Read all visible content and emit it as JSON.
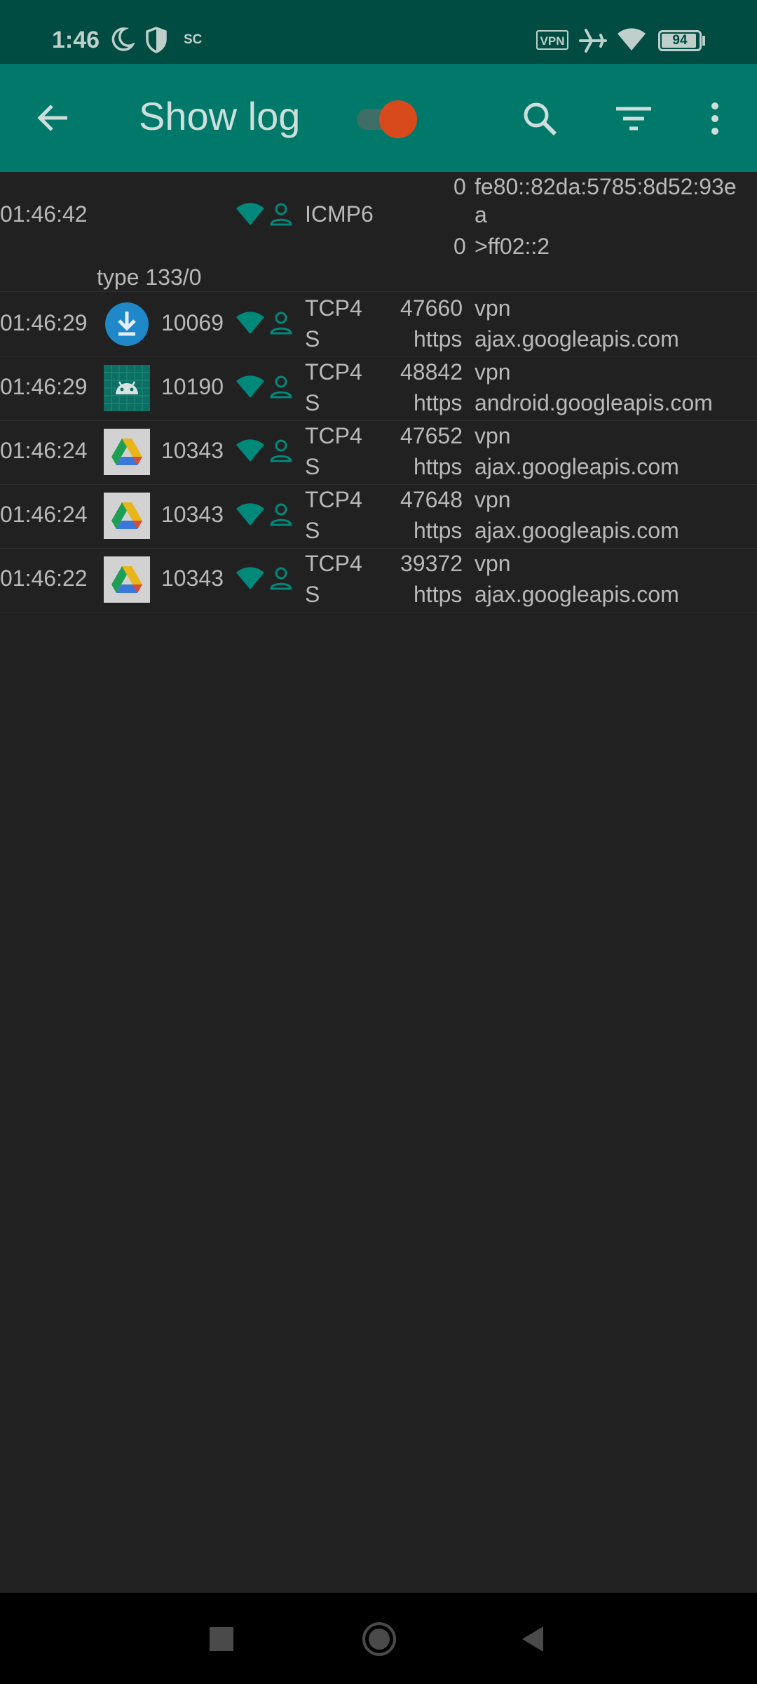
{
  "status_bar": {
    "time": "1:46",
    "sc_label": "SC",
    "vpn_label": "VPN",
    "battery_level": 94,
    "battery_text": "94",
    "icons": [
      "moon-icon",
      "shield-icon",
      "sc-icon",
      "vpn-icon",
      "airplane-icon",
      "wifi-icon",
      "battery-icon"
    ]
  },
  "toolbar": {
    "title": "Show log",
    "toggle_on": true,
    "icons": [
      "back-arrow-icon",
      "search-icon",
      "filter-icon",
      "more-vert-icon"
    ]
  },
  "log": {
    "icmp_entry": {
      "time": "01:46:42",
      "protocol": "ICMP6",
      "src_port": "0",
      "src_addr_line1": "fe80::82da:5785:8d52:93e",
      "src_addr_line2": "a",
      "dst_port": "0",
      "dst_addr": ">ff02::2",
      "type": "type 133/0"
    },
    "entries": [
      {
        "time": "01:46:29",
        "app_icon": "download-icon",
        "uid": "10069",
        "protocol": "TCP4",
        "flags": "S",
        "port": "47660",
        "dest": "vpn",
        "service": "https",
        "host": "ajax.googleapis.com"
      },
      {
        "time": "01:46:29",
        "app_icon": "android-icon",
        "uid": "10190",
        "protocol": "TCP4",
        "flags": "S",
        "port": "48842",
        "dest": "vpn",
        "service": "https",
        "host": "android.googleapis.com"
      },
      {
        "time": "01:46:24",
        "app_icon": "google-drive-icon",
        "uid": "10343",
        "protocol": "TCP4",
        "flags": "S",
        "port": "47652",
        "dest": "vpn",
        "service": "https",
        "host": "ajax.googleapis.com"
      },
      {
        "time": "01:46:24",
        "app_icon": "google-drive-icon",
        "uid": "10343",
        "protocol": "TCP4",
        "flags": "S",
        "port": "47648",
        "dest": "vpn",
        "service": "https",
        "host": "ajax.googleapis.com"
      },
      {
        "time": "01:46:22",
        "app_icon": "google-drive-icon",
        "uid": "10343",
        "protocol": "TCP4",
        "flags": "S",
        "port": "39372",
        "dest": "vpn",
        "service": "https",
        "host": "ajax.googleapis.com"
      }
    ]
  },
  "nav_bar": {
    "icons": [
      "recents-square-icon",
      "home-circle-icon",
      "back-triangle-icon"
    ]
  },
  "colors": {
    "status_bar_bg": "#004c42",
    "toolbar_bg": "#00796b",
    "background": "#212121",
    "accent_teal": "#00796b",
    "toggle_thumb": "#d84a1c",
    "text": "#b9b9b9"
  }
}
